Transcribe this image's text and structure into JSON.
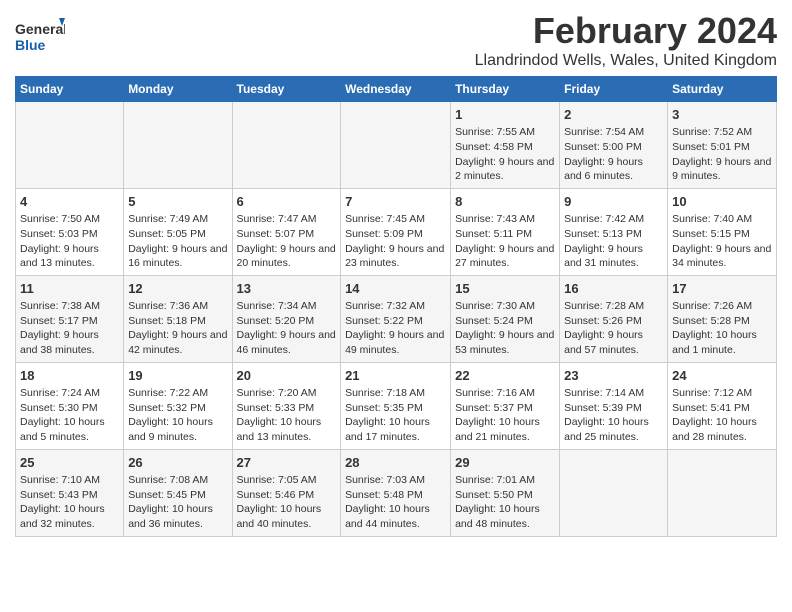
{
  "logo": {
    "line1": "General",
    "line2": "Blue"
  },
  "title": "February 2024",
  "subtitle": "Llandrindod Wells, Wales, United Kingdom",
  "headers": [
    "Sunday",
    "Monday",
    "Tuesday",
    "Wednesday",
    "Thursday",
    "Friday",
    "Saturday"
  ],
  "weeks": [
    [
      {
        "day": "",
        "info": ""
      },
      {
        "day": "",
        "info": ""
      },
      {
        "day": "",
        "info": ""
      },
      {
        "day": "",
        "info": ""
      },
      {
        "day": "1",
        "info": "Sunrise: 7:55 AM\nSunset: 4:58 PM\nDaylight: 9 hours and 2 minutes."
      },
      {
        "day": "2",
        "info": "Sunrise: 7:54 AM\nSunset: 5:00 PM\nDaylight: 9 hours and 6 minutes."
      },
      {
        "day": "3",
        "info": "Sunrise: 7:52 AM\nSunset: 5:01 PM\nDaylight: 9 hours and 9 minutes."
      }
    ],
    [
      {
        "day": "4",
        "info": "Sunrise: 7:50 AM\nSunset: 5:03 PM\nDaylight: 9 hours and 13 minutes."
      },
      {
        "day": "5",
        "info": "Sunrise: 7:49 AM\nSunset: 5:05 PM\nDaylight: 9 hours and 16 minutes."
      },
      {
        "day": "6",
        "info": "Sunrise: 7:47 AM\nSunset: 5:07 PM\nDaylight: 9 hours and 20 minutes."
      },
      {
        "day": "7",
        "info": "Sunrise: 7:45 AM\nSunset: 5:09 PM\nDaylight: 9 hours and 23 minutes."
      },
      {
        "day": "8",
        "info": "Sunrise: 7:43 AM\nSunset: 5:11 PM\nDaylight: 9 hours and 27 minutes."
      },
      {
        "day": "9",
        "info": "Sunrise: 7:42 AM\nSunset: 5:13 PM\nDaylight: 9 hours and 31 minutes."
      },
      {
        "day": "10",
        "info": "Sunrise: 7:40 AM\nSunset: 5:15 PM\nDaylight: 9 hours and 34 minutes."
      }
    ],
    [
      {
        "day": "11",
        "info": "Sunrise: 7:38 AM\nSunset: 5:17 PM\nDaylight: 9 hours and 38 minutes."
      },
      {
        "day": "12",
        "info": "Sunrise: 7:36 AM\nSunset: 5:18 PM\nDaylight: 9 hours and 42 minutes."
      },
      {
        "day": "13",
        "info": "Sunrise: 7:34 AM\nSunset: 5:20 PM\nDaylight: 9 hours and 46 minutes."
      },
      {
        "day": "14",
        "info": "Sunrise: 7:32 AM\nSunset: 5:22 PM\nDaylight: 9 hours and 49 minutes."
      },
      {
        "day": "15",
        "info": "Sunrise: 7:30 AM\nSunset: 5:24 PM\nDaylight: 9 hours and 53 minutes."
      },
      {
        "day": "16",
        "info": "Sunrise: 7:28 AM\nSunset: 5:26 PM\nDaylight: 9 hours and 57 minutes."
      },
      {
        "day": "17",
        "info": "Sunrise: 7:26 AM\nSunset: 5:28 PM\nDaylight: 10 hours and 1 minute."
      }
    ],
    [
      {
        "day": "18",
        "info": "Sunrise: 7:24 AM\nSunset: 5:30 PM\nDaylight: 10 hours and 5 minutes."
      },
      {
        "day": "19",
        "info": "Sunrise: 7:22 AM\nSunset: 5:32 PM\nDaylight: 10 hours and 9 minutes."
      },
      {
        "day": "20",
        "info": "Sunrise: 7:20 AM\nSunset: 5:33 PM\nDaylight: 10 hours and 13 minutes."
      },
      {
        "day": "21",
        "info": "Sunrise: 7:18 AM\nSunset: 5:35 PM\nDaylight: 10 hours and 17 minutes."
      },
      {
        "day": "22",
        "info": "Sunrise: 7:16 AM\nSunset: 5:37 PM\nDaylight: 10 hours and 21 minutes."
      },
      {
        "day": "23",
        "info": "Sunrise: 7:14 AM\nSunset: 5:39 PM\nDaylight: 10 hours and 25 minutes."
      },
      {
        "day": "24",
        "info": "Sunrise: 7:12 AM\nSunset: 5:41 PM\nDaylight: 10 hours and 28 minutes."
      }
    ],
    [
      {
        "day": "25",
        "info": "Sunrise: 7:10 AM\nSunset: 5:43 PM\nDaylight: 10 hours and 32 minutes."
      },
      {
        "day": "26",
        "info": "Sunrise: 7:08 AM\nSunset: 5:45 PM\nDaylight: 10 hours and 36 minutes."
      },
      {
        "day": "27",
        "info": "Sunrise: 7:05 AM\nSunset: 5:46 PM\nDaylight: 10 hours and 40 minutes."
      },
      {
        "day": "28",
        "info": "Sunrise: 7:03 AM\nSunset: 5:48 PM\nDaylight: 10 hours and 44 minutes."
      },
      {
        "day": "29",
        "info": "Sunrise: 7:01 AM\nSunset: 5:50 PM\nDaylight: 10 hours and 48 minutes."
      },
      {
        "day": "",
        "info": ""
      },
      {
        "day": "",
        "info": ""
      }
    ]
  ]
}
